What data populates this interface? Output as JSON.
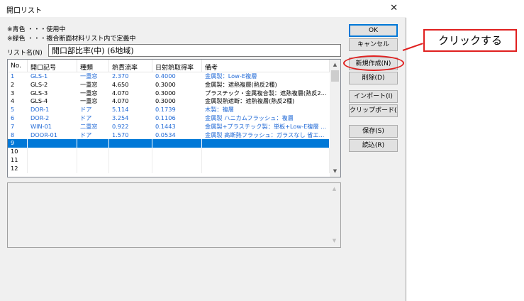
{
  "window": {
    "title": "開口リスト"
  },
  "legend": {
    "line1": "※青色 ・・・使用中",
    "line2": "※緑色 ・・・複合断面材料リスト内で定義中"
  },
  "list_name": {
    "label": "リスト名(N)",
    "value": "開口部比率(中) (6地域)"
  },
  "table": {
    "headers": [
      "No.",
      "開口記号",
      "種類",
      "熱貫流率",
      "日射熱取得率",
      "備考"
    ],
    "rows": [
      {
        "no": "1",
        "code": "GLS-1",
        "type": "一重窓",
        "u": "2.370",
        "eta": "0.4000",
        "note": "金属製：Low-E複層",
        "color": "blue"
      },
      {
        "no": "2",
        "code": "GLS-2",
        "type": "一重窓",
        "u": "4.650",
        "eta": "0.3000",
        "note": "金属製：遮熱複層(熱反2種)",
        "color": "black"
      },
      {
        "no": "3",
        "code": "GLS-3",
        "type": "一重窓",
        "u": "4.070",
        "eta": "0.3000",
        "note": "プラスチック・金属複合製：遮熱複層(熱反2...",
        "color": "black"
      },
      {
        "no": "4",
        "code": "GLS-4",
        "type": "一重窓",
        "u": "4.070",
        "eta": "0.3000",
        "note": "金属製熱遮断：遮熱複層(熱反2種)",
        "color": "black"
      },
      {
        "no": "5",
        "code": "DOR-1",
        "type": "ドア",
        "u": "5.114",
        "eta": "0.1739",
        "note": "木製：複層",
        "color": "blue"
      },
      {
        "no": "6",
        "code": "DOR-2",
        "type": "ドア",
        "u": "3.254",
        "eta": "0.1106",
        "note": "金属製 ハニカムフラッシュ：複層",
        "color": "blue"
      },
      {
        "no": "7",
        "code": "WIN-01",
        "type": "二重窓",
        "u": "0.922",
        "eta": "0.1443",
        "note": "金属製+プラスチック製：単板+Low-E複層 ...",
        "color": "blue"
      },
      {
        "no": "8",
        "code": "DOOR-01",
        "type": "ドア",
        "u": "1.570",
        "eta": "0.0534",
        "note": "金属製 高断熱フラッシュ：ガラスなし 省エ...",
        "color": "blue"
      },
      {
        "no": "9",
        "code": "",
        "type": "",
        "u": "",
        "eta": "",
        "note": "",
        "color": "selected"
      },
      {
        "no": "10",
        "code": "",
        "type": "",
        "u": "",
        "eta": "",
        "note": "",
        "color": "empty"
      },
      {
        "no": "11",
        "code": "",
        "type": "",
        "u": "",
        "eta": "",
        "note": "",
        "color": "empty"
      },
      {
        "no": "12",
        "code": "",
        "type": "",
        "u": "",
        "eta": "",
        "note": "",
        "color": "empty"
      }
    ]
  },
  "buttons": {
    "ok": "OK",
    "cancel": "キャンセル",
    "new": "新規作成(N)",
    "delete": "削除(D)",
    "import": "インポート(I)",
    "clipboard": "クリップボード(C)",
    "save": "保存(S)",
    "load": "読込(R)"
  },
  "icons": {
    "close": "close-icon",
    "scroll_up": "chevron-up-icon",
    "scroll_down": "chevron-down-icon"
  },
  "annotation": {
    "callout_text": "クリックする",
    "color": "#e0201f"
  },
  "colors": {
    "used_row": "#1f68d6",
    "selection": "#0078d7"
  }
}
